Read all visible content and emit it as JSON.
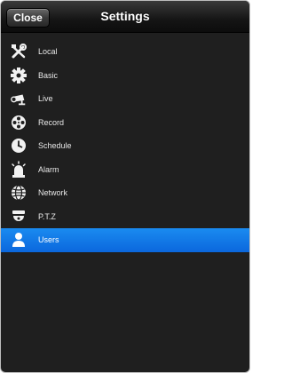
{
  "header": {
    "close_label": "Close",
    "title": "Settings"
  },
  "menu": {
    "items": [
      {
        "label": "Local",
        "icon": "tools-icon"
      },
      {
        "label": "Basic",
        "icon": "gear-icon"
      },
      {
        "label": "Live",
        "icon": "camera-icon"
      },
      {
        "label": "Record",
        "icon": "film-reel-icon"
      },
      {
        "label": "Schedule",
        "icon": "clock-icon"
      },
      {
        "label": "Alarm",
        "icon": "alarm-light-icon"
      },
      {
        "label": "Network",
        "icon": "globe-icon"
      },
      {
        "label": "P.T.Z",
        "icon": "dome-camera-icon"
      },
      {
        "label": "Users",
        "icon": "user-icon",
        "selected": true
      }
    ]
  },
  "colors": {
    "selected_bg": "#0b72e7",
    "panel_bg": "#1f1f1f"
  }
}
